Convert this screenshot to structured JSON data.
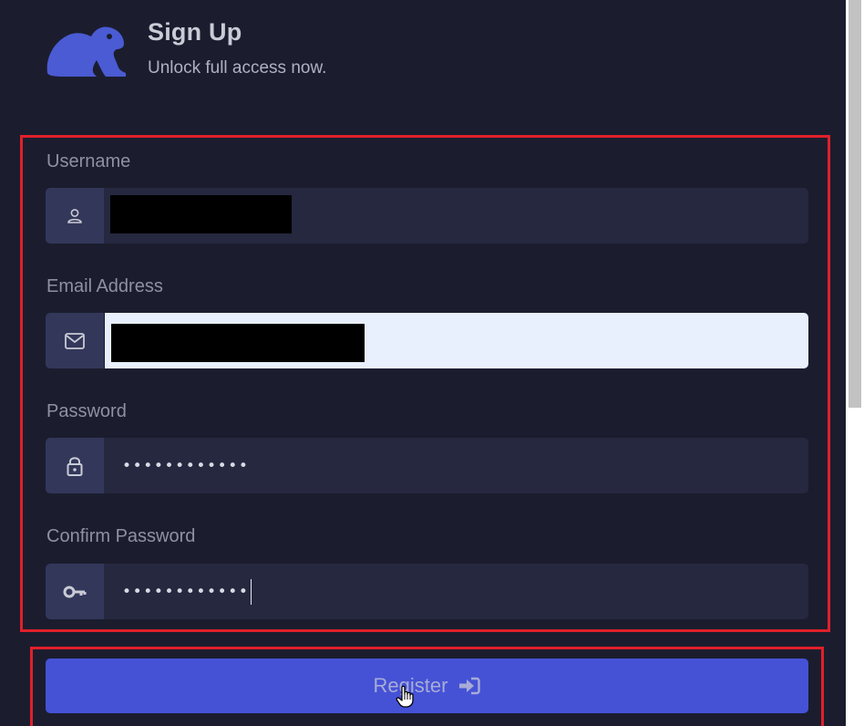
{
  "header": {
    "title": "Sign Up",
    "subtitle": "Unlock full access now."
  },
  "form": {
    "username": {
      "label": "Username",
      "icon": "user-icon",
      "value_redacted": true
    },
    "email": {
      "label": "Email Address",
      "icon": "envelope-icon",
      "value_redacted": true
    },
    "password": {
      "label": "Password",
      "icon": "lock-icon",
      "masked_value": "••••••••••••"
    },
    "confirm_password": {
      "label": "Confirm Password",
      "icon": "key-icon",
      "masked_value": "••••••••••••"
    }
  },
  "register_button": {
    "label": "Register",
    "icon": "sign-in-icon"
  },
  "colors": {
    "background": "#1b1d2e",
    "input_bg": "#25283f",
    "addon_bg": "#33375a",
    "accent": "#4552d6",
    "highlight": "#e0202a"
  }
}
